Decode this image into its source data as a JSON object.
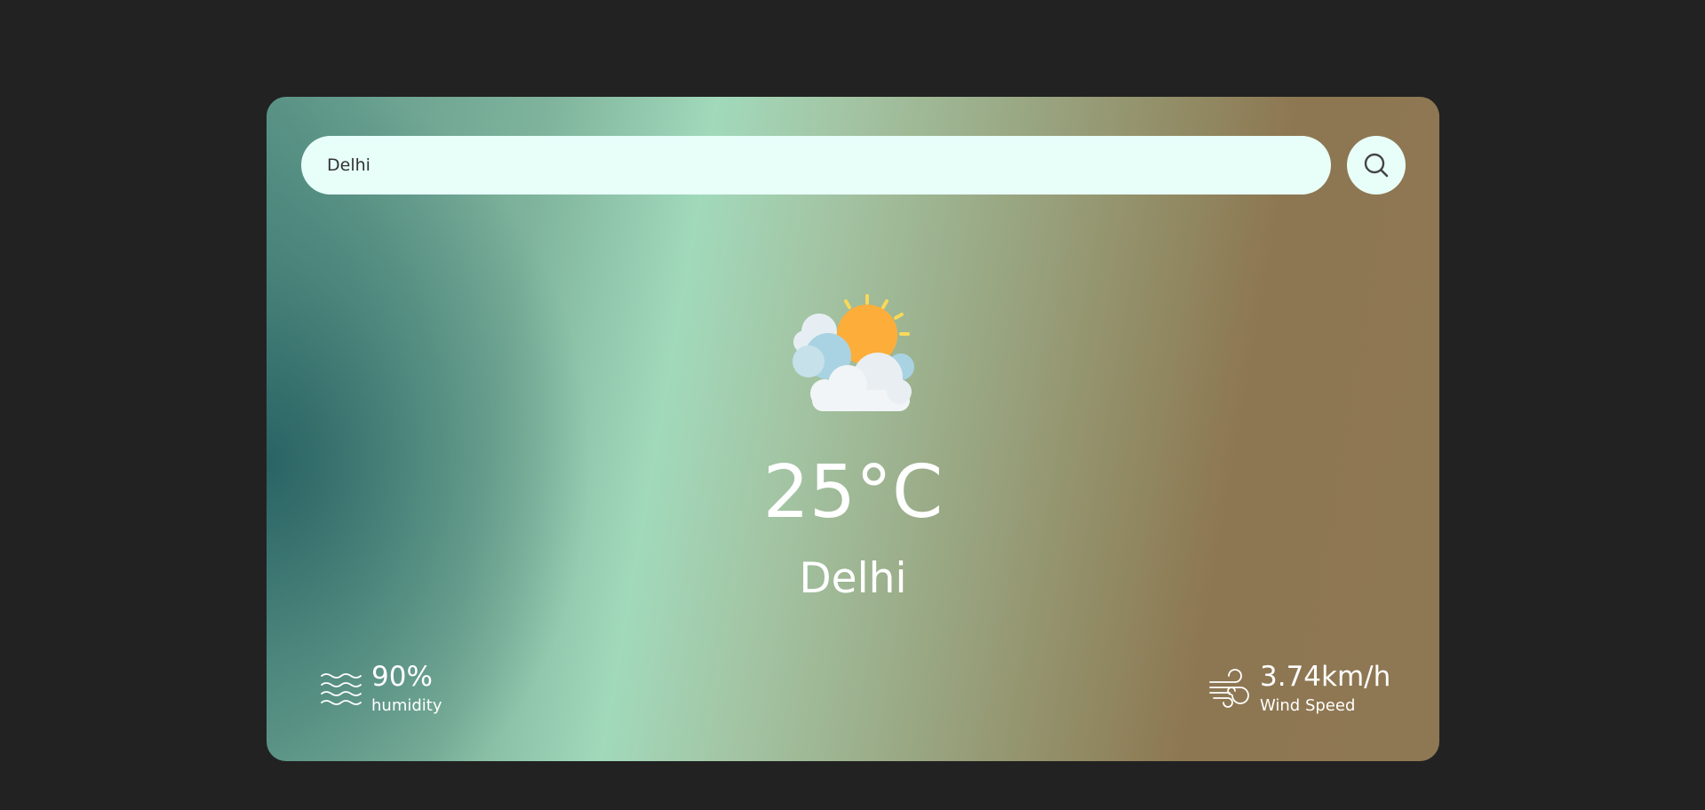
{
  "search": {
    "value": "Delhi"
  },
  "weather": {
    "icon": "partly-cloudy-icon",
    "temperature": "25°C",
    "city": "Delhi"
  },
  "humidity": {
    "value": "90%",
    "label": "humidity",
    "icon": "waves-icon"
  },
  "wind": {
    "value": "3.74km/h",
    "label": "Wind Speed",
    "icon": "wind-icon"
  }
}
